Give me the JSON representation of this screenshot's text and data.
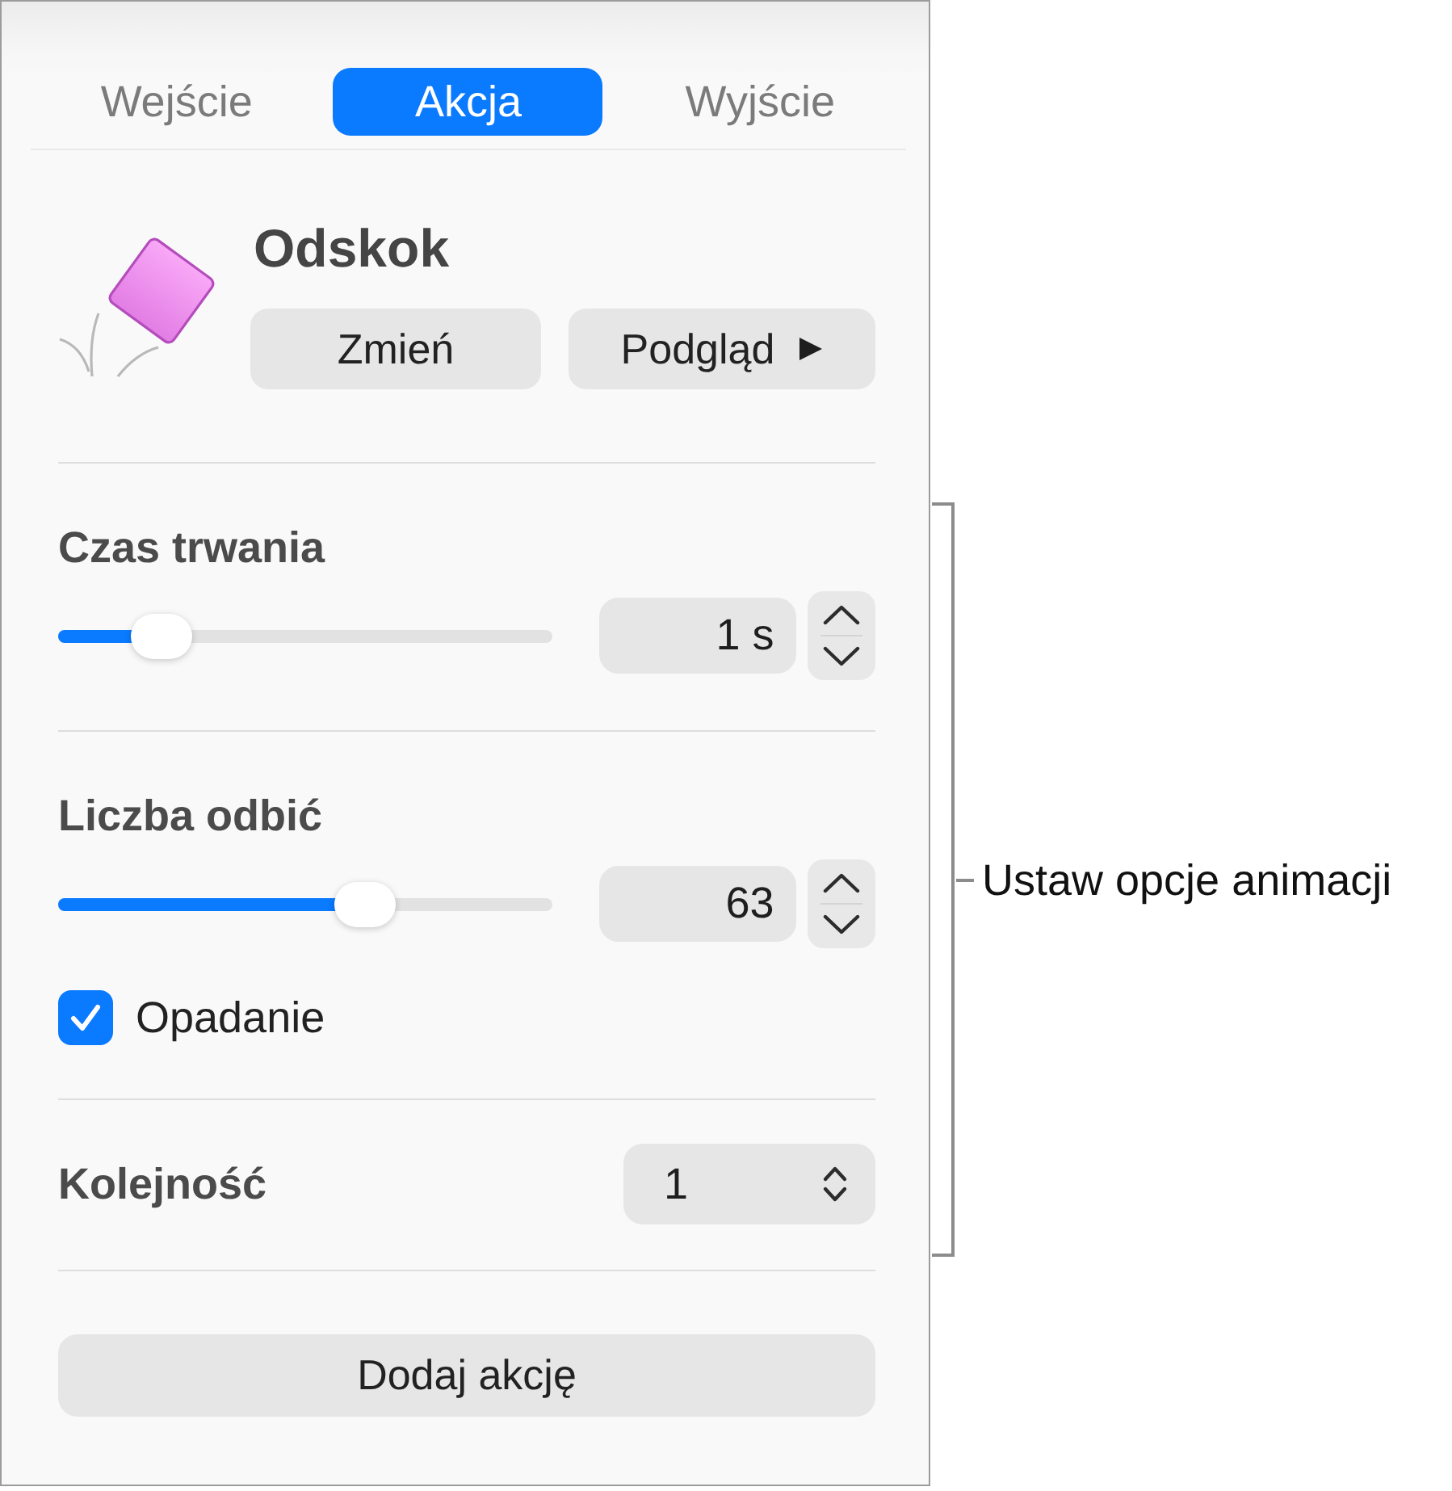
{
  "tabs": [
    {
      "label": "Wejście",
      "selected": false
    },
    {
      "label": "Akcja",
      "selected": true
    },
    {
      "label": "Wyjście",
      "selected": false
    }
  ],
  "effect": {
    "title": "Odskok",
    "change_button": "Zmień",
    "preview_button": "Podgląd"
  },
  "sliders": [
    {
      "label": "Czas trwania",
      "level": 0.21,
      "value": "1 s"
    },
    {
      "label": "Liczba odbić",
      "level": 0.62,
      "value": "63",
      "checkbox": {
        "label": "Opadanie",
        "checked": true
      }
    }
  ],
  "order": {
    "label": "Kolejność",
    "value": "1"
  },
  "add_button": "Dodaj akcję",
  "callout": {
    "label": "Ustaw opcje animacji"
  }
}
